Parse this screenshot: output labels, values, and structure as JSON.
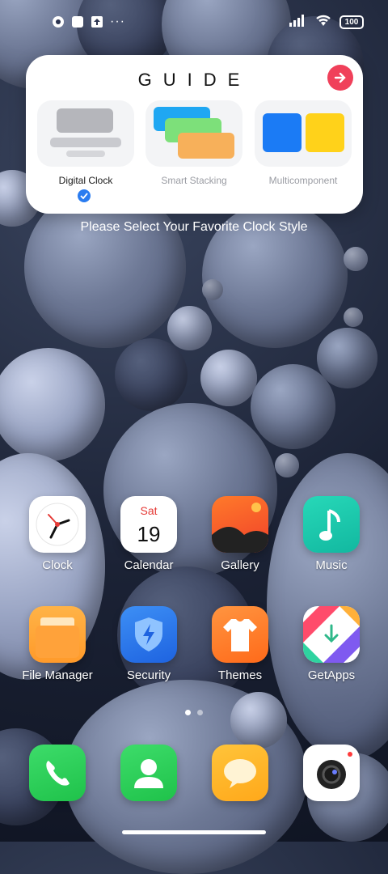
{
  "status_bar": {
    "left_icons": [
      "notification-icon",
      "app-icon",
      "upload-icon",
      "more-dots-icon"
    ],
    "more": "···",
    "battery": "100",
    "right_icons": [
      "signal-icon",
      "wifi-icon",
      "battery-icon"
    ]
  },
  "guide": {
    "title": "GUIDE",
    "options": [
      {
        "label": "Digital Clock",
        "selected": true
      },
      {
        "label": "Smart Stacking",
        "selected": false
      },
      {
        "label": "Multicomponent",
        "selected": false
      }
    ],
    "hint": "Please Select Your Favorite Clock Style"
  },
  "apps": {
    "row1": [
      {
        "label": "Clock"
      },
      {
        "label": "Calendar",
        "day": "Sat",
        "date": "19"
      },
      {
        "label": "Gallery"
      },
      {
        "label": "Music"
      }
    ],
    "row2": [
      {
        "label": "File Manager"
      },
      {
        "label": "Security"
      },
      {
        "label": "Themes"
      },
      {
        "label": "GetApps"
      }
    ]
  },
  "dock": [
    "phone-icon",
    "contacts-icon",
    "messages-icon",
    "camera-icon"
  ],
  "page_indicator": {
    "pages": 2,
    "current": 1
  },
  "colors": {
    "accent": "#f0405a",
    "check": "#2a7cf0"
  }
}
